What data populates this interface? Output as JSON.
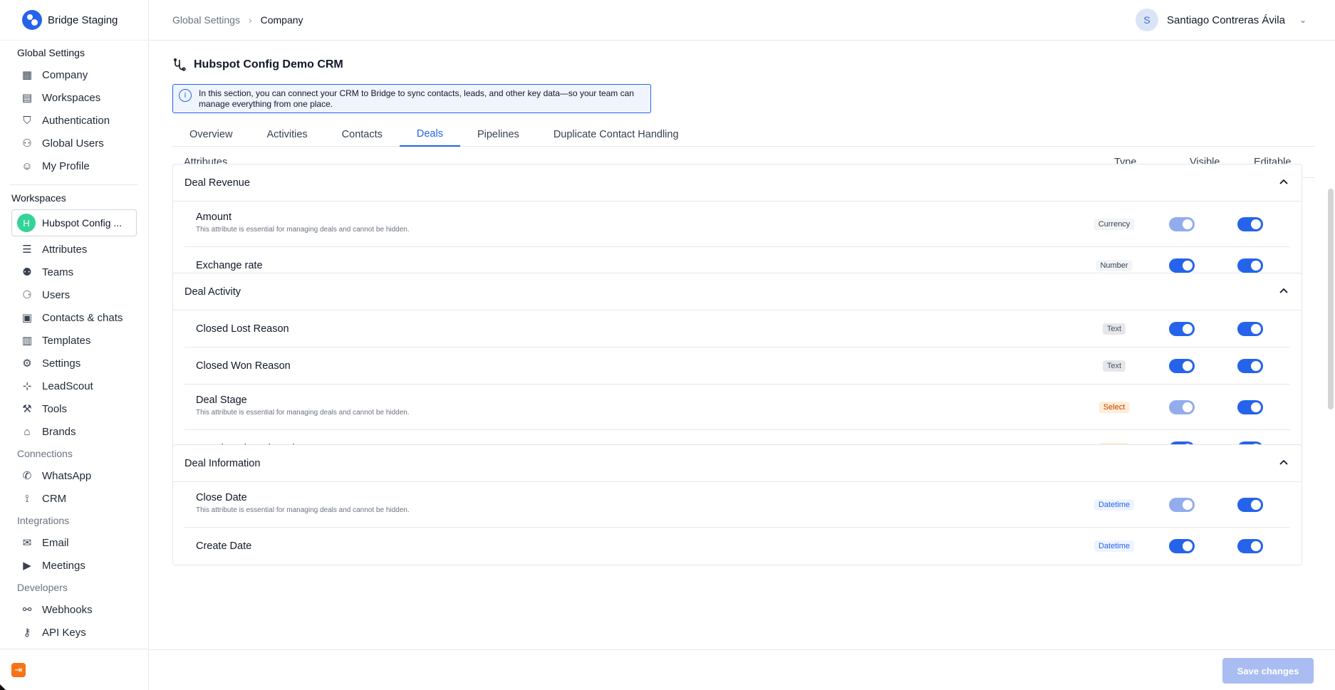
{
  "brand": {
    "name": "Bridge Staging"
  },
  "sidebar": {
    "global_title": "Global Settings",
    "global_items": [
      {
        "label": "Company",
        "icon": "building-icon"
      },
      {
        "label": "Workspaces",
        "icon": "workspaces-icon"
      },
      {
        "label": "Authentication",
        "icon": "shield-icon"
      },
      {
        "label": "Global Users",
        "icon": "users-icon"
      },
      {
        "label": "My Profile",
        "icon": "user-icon"
      }
    ],
    "workspaces_title": "Workspaces",
    "workspace": {
      "initial": "H",
      "name": "Hubspot Config ..."
    },
    "workspace_items": [
      {
        "label": "Attributes",
        "icon": "database-icon"
      },
      {
        "label": "Teams",
        "icon": "team-icon"
      },
      {
        "label": "Users",
        "icon": "user-gear-icon"
      },
      {
        "label": "Contacts & chats",
        "icon": "contact-book-icon"
      },
      {
        "label": "Templates",
        "icon": "template-icon"
      },
      {
        "label": "Settings",
        "icon": "gear-icon"
      },
      {
        "label": "LeadScout",
        "icon": "leadscout-icon"
      },
      {
        "label": "Tools",
        "icon": "wrench-icon"
      },
      {
        "label": "Brands",
        "icon": "tag-icon"
      }
    ],
    "connections_title": "Connections",
    "connections_items": [
      {
        "label": "WhatsApp",
        "icon": "whatsapp-icon"
      },
      {
        "label": "CRM",
        "icon": "crm-icon"
      }
    ],
    "integrations_title": "Integrations",
    "integrations_items": [
      {
        "label": "Email",
        "icon": "mail-icon"
      },
      {
        "label": "Meetings",
        "icon": "video-icon"
      }
    ],
    "developers_title": "Developers",
    "developers_items": [
      {
        "label": "Webhooks",
        "icon": "webhook-icon"
      },
      {
        "label": "API Keys",
        "icon": "key-icon"
      }
    ]
  },
  "breadcrumb": {
    "parent": "Global Settings",
    "current": "Company"
  },
  "user": {
    "initial": "S",
    "name": "Santiago Contreras Ávila"
  },
  "page": {
    "title": "Hubspot Config Demo CRM",
    "info": "In this section, you can connect your CRM to Bridge to sync contacts, leads, and other key data—so your team can manage everything from one place."
  },
  "tabs": [
    "Overview",
    "Activities",
    "Contacts",
    "Deals",
    "Pipelines",
    "Duplicate Contact Handling"
  ],
  "active_tab": "Deals",
  "table_head": {
    "attributes": "Attributes",
    "type": "Type",
    "visible": "Visible",
    "editable": "Editable"
  },
  "essential_note": "This attribute is essential for managing deals and cannot be hidden.",
  "groups": [
    {
      "title": "Deal Revenue",
      "rows": [
        {
          "name": "Amount",
          "type": "Currency",
          "essential": true,
          "visible": true,
          "editable": true
        },
        {
          "name": "Exchange rate",
          "type": "Number",
          "essential": false,
          "visible": true,
          "editable": true
        }
      ]
    },
    {
      "title": "Deal Activity",
      "rows": [
        {
          "name": "Closed Lost Reason",
          "type": "Text",
          "essential": false,
          "visible": true,
          "editable": true
        },
        {
          "name": "Closed Won Reason",
          "type": "Text",
          "essential": false,
          "visible": true,
          "editable": true
        },
        {
          "name": "Deal Stage",
          "type": "Select",
          "essential": true,
          "visible": true,
          "editable": true
        },
        {
          "name": "Is Active Shared Deal",
          "type": "Select",
          "essential": false,
          "visible": true,
          "editable": true
        }
      ]
    },
    {
      "title": "Deal Information",
      "rows": [
        {
          "name": "Close Date",
          "type": "Datetime",
          "essential": true,
          "visible": true,
          "editable": true
        },
        {
          "name": "Create Date",
          "type": "Datetime",
          "essential": false,
          "visible": true,
          "editable": true
        }
      ]
    }
  ],
  "footer": {
    "save_label": "Save changes"
  },
  "colors": {
    "accent": "#2563eb",
    "toggle_disabled": "#93acee",
    "select_badge": "#ffedd5",
    "save_disabled": "#a9bdf2"
  }
}
